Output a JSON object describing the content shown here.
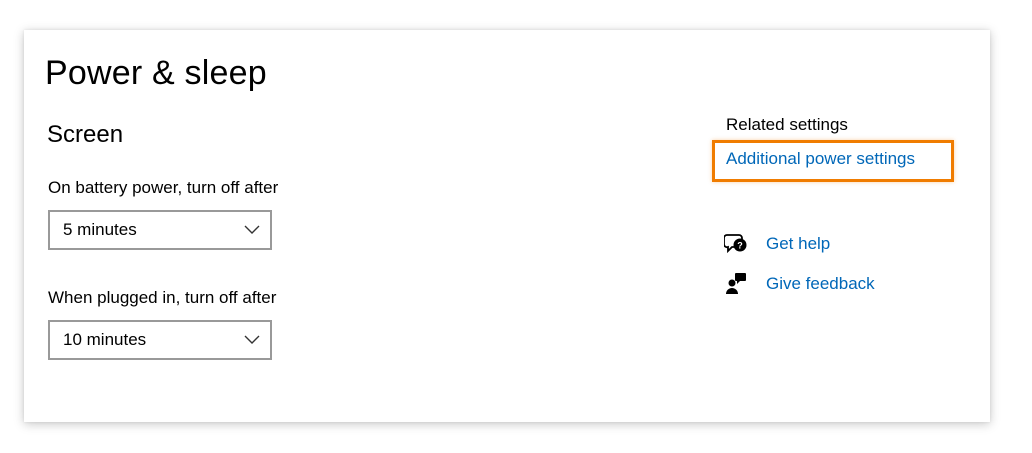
{
  "page": {
    "title": "Power & sleep"
  },
  "screen": {
    "section_title": "Screen",
    "battery": {
      "label": "On battery power, turn off after",
      "value": "5 minutes"
    },
    "plugged": {
      "label": "When plugged in, turn off after",
      "value": "10 minutes"
    }
  },
  "related": {
    "heading": "Related settings",
    "link_label": "Additional power settings",
    "highlight_color": "#f07c00",
    "link_color": "#0067b8"
  },
  "help": {
    "items": [
      {
        "label": "Get help",
        "icon": "chat-help-icon"
      },
      {
        "label": "Give feedback",
        "icon": "feedback-person-icon"
      }
    ]
  }
}
